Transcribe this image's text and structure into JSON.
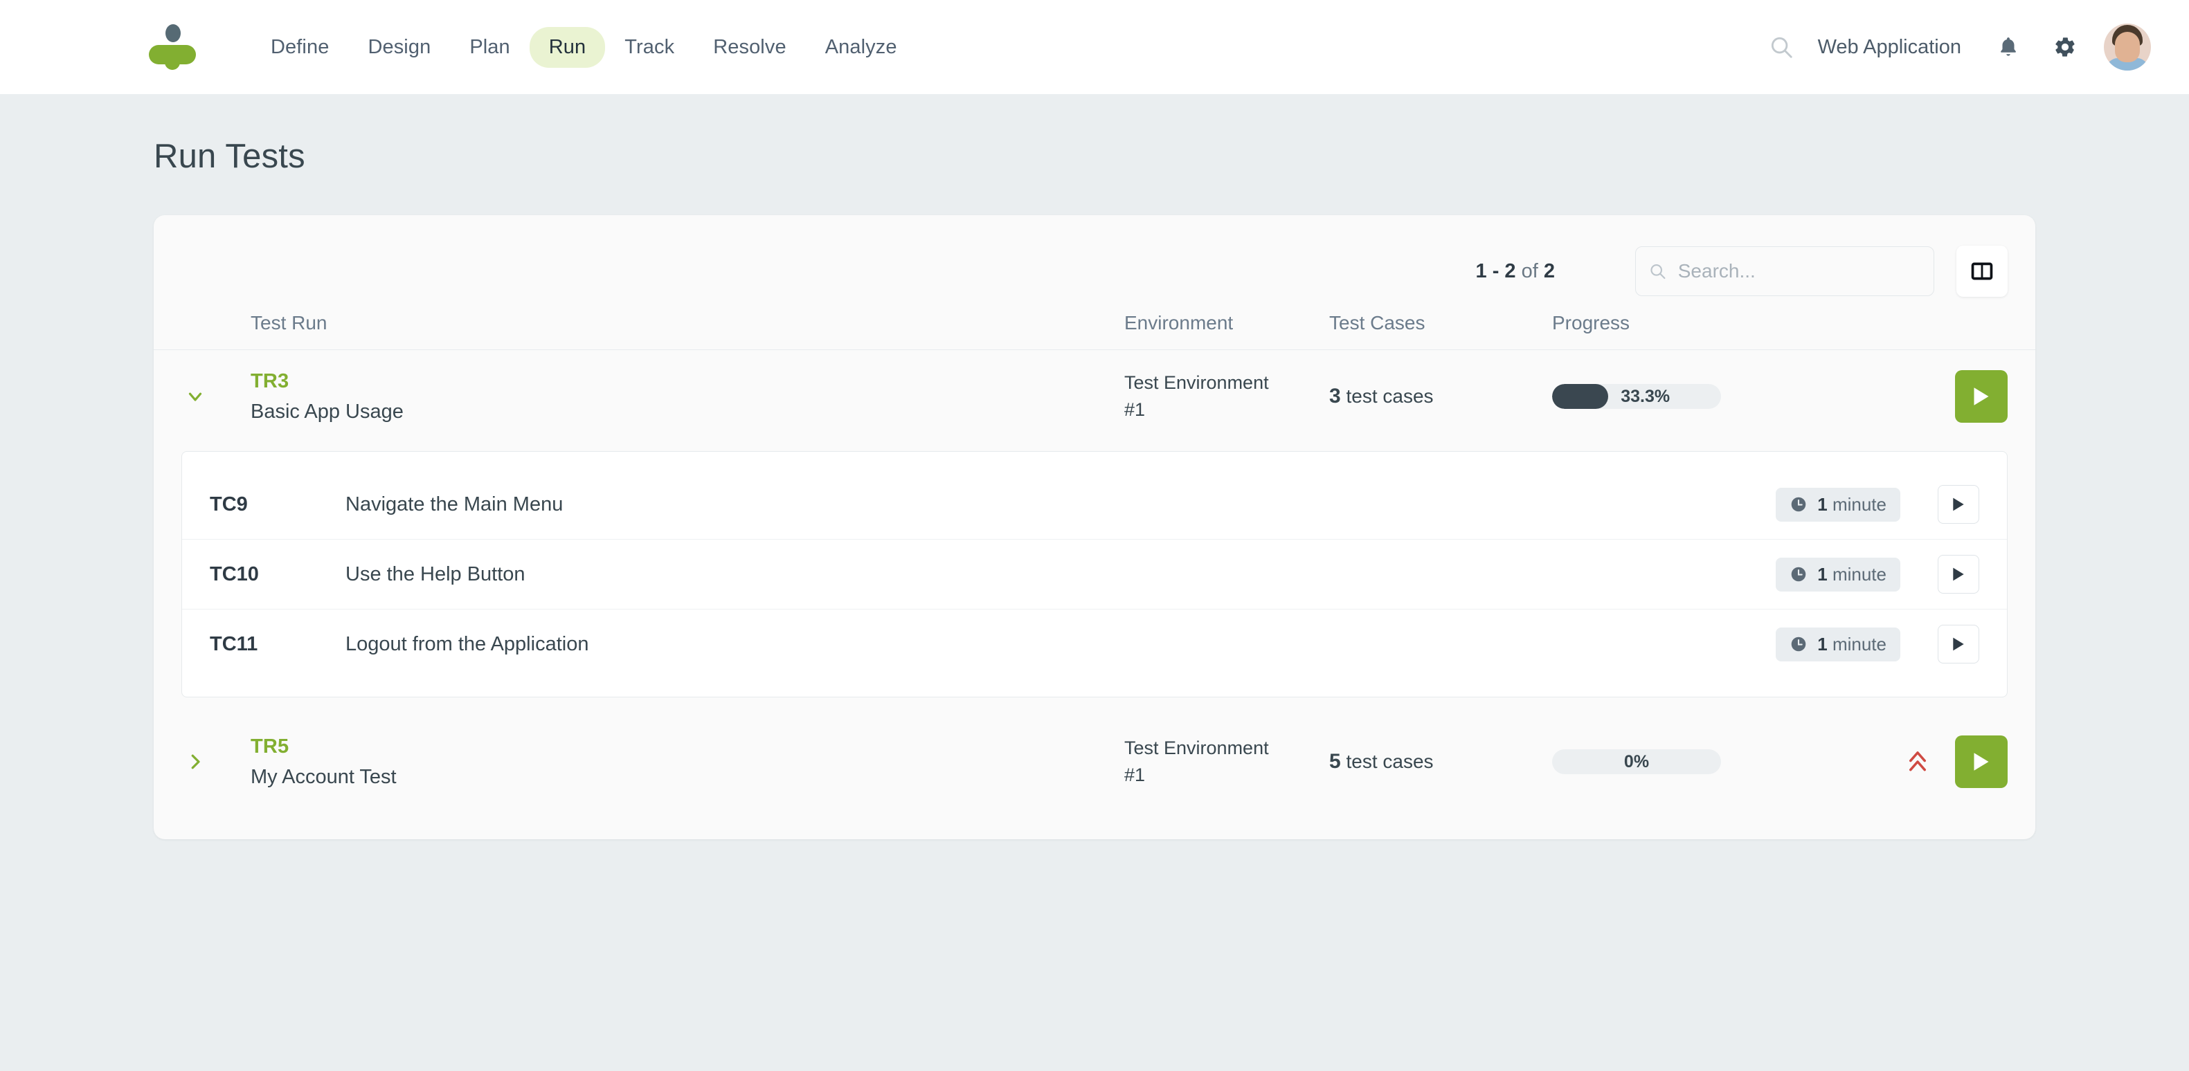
{
  "brand": {
    "logo_name": "testmo-logo",
    "green": "#82af31",
    "dark": "#3a4750"
  },
  "topbar": {
    "nav_items": [
      {
        "label": "Define",
        "active": false
      },
      {
        "label": "Design",
        "active": false
      },
      {
        "label": "Plan",
        "active": false
      },
      {
        "label": "Run",
        "active": true
      },
      {
        "label": "Track",
        "active": false
      },
      {
        "label": "Resolve",
        "active": false
      },
      {
        "label": "Analyze",
        "active": false
      }
    ],
    "search_icon": "search-icon",
    "project_name": "Web Application",
    "bell_icon": "bell-icon",
    "gear_icon": "gear-icon",
    "avatar": "user-avatar"
  },
  "page": {
    "title": "Run Tests"
  },
  "toolbar": {
    "pagination_range": "1 - 2",
    "pagination_of": "of",
    "pagination_total": "2",
    "search_placeholder": "Search...",
    "search_value": "",
    "columns_icon": "columns-layout-icon"
  },
  "table": {
    "headers": {
      "test_run": "Test Run",
      "environment": "Environment",
      "test_cases": "Test Cases",
      "progress": "Progress"
    },
    "rows": [
      {
        "expanded": true,
        "caret_icon": "chevron-down-icon",
        "id": "TR3",
        "name": "Basic App Usage",
        "environment": "Test Environment #1",
        "test_cases_count": "3",
        "test_cases_label": "test cases",
        "progress_percent": 33.3,
        "progress_label": "33.3%",
        "priority_icon": null,
        "run_button_icon": "play-icon",
        "test_cases": [
          {
            "id": "TC9",
            "name": "Navigate the Main Menu",
            "duration_value": "1",
            "duration_unit": "minute",
            "clock_icon": "clock-icon",
            "run_button_icon": "play-icon"
          },
          {
            "id": "TC10",
            "name": "Use the Help Button",
            "duration_value": "1",
            "duration_unit": "minute",
            "clock_icon": "clock-icon",
            "run_button_icon": "play-icon"
          },
          {
            "id": "TC11",
            "name": "Logout from the Application",
            "duration_value": "1",
            "duration_unit": "minute",
            "clock_icon": "clock-icon",
            "run_button_icon": "play-icon"
          }
        ]
      },
      {
        "expanded": false,
        "caret_icon": "chevron-right-icon",
        "id": "TR5",
        "name": "My Account Test",
        "environment": "Test Environment #1",
        "test_cases_count": "5",
        "test_cases_label": "test cases",
        "progress_percent": 0,
        "progress_label": "0%",
        "priority_icon": "priority-high-icon",
        "priority_color": "#cf4a42",
        "run_button_icon": "play-icon",
        "test_cases": []
      }
    ]
  }
}
